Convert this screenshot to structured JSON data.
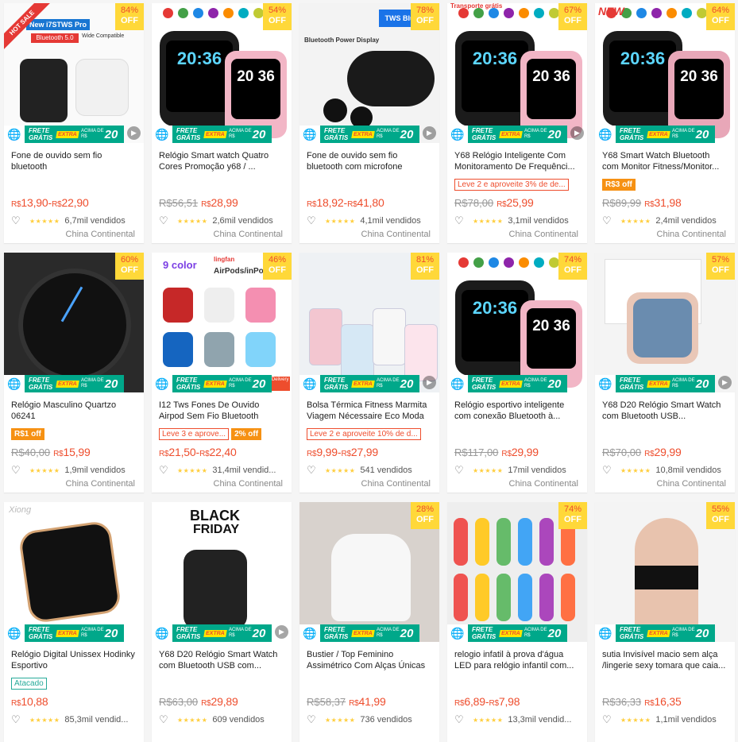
{
  "labels": {
    "frete": "FRETE",
    "gratis": "GRÁTIS",
    "extra": "EXTRA",
    "acima": "ACIMA DE",
    "acima_val": "R$",
    "off": "OFF",
    "currency": "R$"
  },
  "colors": {
    "accent": "#ee4d2d",
    "discount_bg": "#ffd839",
    "freeship": "#00a88a",
    "star": "#ffce3d"
  },
  "products": [
    {
      "title": "Fone de ouvido sem fio bluetooth",
      "discount": "84%",
      "old_price": "",
      "price": "13,90",
      "price_max": "22,90",
      "promo": "",
      "promo_fill": "",
      "rating": 5,
      "sold": "6,7mil vendidos",
      "origin": "China Continental",
      "ribbon": "HOT SALE",
      "badge_text": "New i7STWS Pro",
      "badge_sub": "Bluetooth 5.0",
      "badge_note": "Wide Compatible",
      "video": true
    },
    {
      "title": "Relógio Smart watch Quatro Cores Promoção y68 / ...",
      "discount": "54%",
      "old_price": "56,51",
      "price": "28,99",
      "price_max": "",
      "promo": "",
      "promo_fill": "",
      "rating": 5,
      "sold": "2,6mil vendidos",
      "origin": "China Continental",
      "watch_a": "20:36",
      "watch_b": "20 36",
      "video": false
    },
    {
      "title": "Fone de ouvido sem fio bluetooth com microfone",
      "discount": "78%",
      "old_price": "",
      "price": "18,92",
      "price_max": "41,80",
      "promo": "",
      "promo_fill": "",
      "rating": 4.5,
      "sold": "4,1mil vendidos",
      "origin": "China Continental",
      "badge_text": "TWS Bluet",
      "badge_sub": "Bluetooth Power Display",
      "video": true
    },
    {
      "title": "Y68 Relógio Inteligente Com Monitoramento De Frequênci...",
      "discount": "67%",
      "old_price": "78,00",
      "price": "25,99",
      "price_max": "",
      "promo": "Leve 2 e aproveite 3% de de...",
      "promo_fill": "",
      "rating": 5,
      "sold": "3,1mil vendidos",
      "origin": "China Continental",
      "badge_text": "Transporte grátis",
      "watch_a": "20:36",
      "watch_b": "20 36",
      "video": true
    },
    {
      "title": "Y68 Smart Watch Bluetooth com Monitor Fitness/Monitor...",
      "discount": "64%",
      "old_price": "89,99",
      "price": "31,98",
      "price_max": "",
      "promo": "",
      "promo_fill": "R$3 off",
      "rating": 5,
      "sold": "2,4mil vendidos",
      "origin": "China Continental",
      "badge_text": "NEW",
      "watch_a": "20:36",
      "watch_b": "20 36",
      "video": false
    },
    {
      "title": "Relógio Masculino Quartzo 06241",
      "discount": "60%",
      "old_price": "40,00",
      "price": "15,99",
      "price_max": "",
      "promo": "",
      "promo_fill": "R$1 off",
      "rating": 5,
      "sold": "1,9mil vendidos",
      "origin": "China Continental",
      "video": false
    },
    {
      "title": "I12 Tws Fones De Ouvido Airpod Sem Fio Bluetooth",
      "discount": "46%",
      "old_price": "",
      "price": "21,50",
      "price_max": "22,40",
      "promo": "Leve 3 e aprove...",
      "promo_fill": "2% off",
      "rating": 5,
      "sold": "31,4mil vendid...",
      "origin": "China Continental",
      "badge_text": "9 color",
      "badge_sub": "AirPods/inPo",
      "badge_note": "lingfan",
      "badge_fast": "Fast Delivery",
      "video": false
    },
    {
      "title": "Bolsa Térmica Fitness Marmita Viagem Nécessaire Eco Moda",
      "discount": "81%",
      "old_price": "",
      "price": "9,99",
      "price_max": "27,99",
      "promo": "Leve 2 e aproveite 10% de d...",
      "promo_fill": "",
      "rating": 5,
      "sold": "541 vendidos",
      "origin": "China Continental",
      "video": true
    },
    {
      "title": "Relógio esportivo inteligente com conexão Bluetooth à...",
      "discount": "74%",
      "old_price": "117,00",
      "price": "29,99",
      "price_max": "",
      "promo": "",
      "promo_fill": "",
      "rating": 5,
      "sold": "17mil vendidos",
      "origin": "China Continental",
      "watch_a": "20:36",
      "watch_b": "20 36",
      "video": false
    },
    {
      "title": "Y68 D20 Relógio Smart Watch com Bluetooth USB...",
      "discount": "57%",
      "old_price": "70,00",
      "price": "29,99",
      "price_max": "",
      "promo": "",
      "promo_fill": "",
      "rating": 5,
      "sold": "10,8mil vendidos",
      "origin": "China Continental",
      "video": true
    },
    {
      "title": "Relógio Digital Unissex Hodinky Esportivo",
      "discount": "",
      "old_price": "",
      "price": "10,88",
      "price_max": "",
      "promo": "Atacado",
      "promo_fill": "",
      "rating": 5,
      "sold": "85,3mil vendid...",
      "origin": "",
      "watermark": "Xiong",
      "video": false
    },
    {
      "title": "Y68 D20 Relógio Smart Watch com Bluetooth USB com...",
      "discount": "",
      "old_price": "63,00",
      "price": "29,89",
      "price_max": "",
      "promo": "",
      "promo_fill": "",
      "rating": 5,
      "sold": "609 vendidos",
      "origin": "",
      "badge_text": "BLACK",
      "badge_sub": "FRIDAY",
      "video": true
    },
    {
      "title": "Bustier / Top Feminino Assimétrico Com Alças Únicas",
      "discount": "28%",
      "old_price": "58,37",
      "price": "41,99",
      "price_max": "",
      "promo": "",
      "promo_fill": "",
      "rating": 5,
      "sold": "736 vendidos",
      "origin": "",
      "video": false
    },
    {
      "title": "relogio infatil à prova d'água LED para relógio infantil com...",
      "discount": "74%",
      "old_price": "",
      "price": "6,89",
      "price_max": "7,98",
      "promo": "",
      "promo_fill": "",
      "rating": 5,
      "sold": "13,3mil vendid...",
      "origin": "",
      "video": false
    },
    {
      "title": "sutia Invisível macio sem alça /lingerie sexy tomara que caia...",
      "discount": "55%",
      "old_price": "36,33",
      "price": "16,35",
      "price_max": "",
      "promo": "",
      "promo_fill": "",
      "rating": 5,
      "sold": "1,1mil vendidos",
      "origin": "",
      "video": false
    }
  ]
}
